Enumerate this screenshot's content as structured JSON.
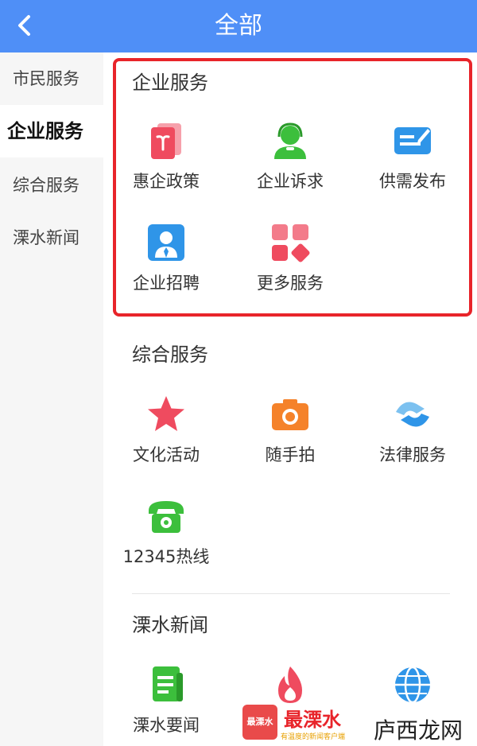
{
  "header": {
    "title": "全部"
  },
  "sidebar": {
    "items": [
      {
        "label": "市民服务"
      },
      {
        "label": "企业服务"
      },
      {
        "label": "综合服务"
      },
      {
        "label": "溧水新闻"
      }
    ]
  },
  "sections": {
    "enterprise": {
      "title": "企业服务",
      "items": [
        {
          "label": "惠企政策",
          "icon": "policy-book-icon",
          "color": "#ef4b5f"
        },
        {
          "label": "企业诉求",
          "icon": "customer-service-icon",
          "color": "#3cbf3c"
        },
        {
          "label": "供需发布",
          "icon": "publish-card-icon",
          "color": "#2f95e8"
        },
        {
          "label": "企业招聘",
          "icon": "recruit-person-icon",
          "color": "#2f95e8"
        },
        {
          "label": "更多服务",
          "icon": "more-grid-icon",
          "color": "#ef4b5f"
        }
      ]
    },
    "general": {
      "title": "综合服务",
      "items": [
        {
          "label": "文化活动",
          "icon": "star-icon",
          "color": "#ef4b5f"
        },
        {
          "label": "随手拍",
          "icon": "camera-icon",
          "color": "#f5822a"
        },
        {
          "label": "法律服务",
          "icon": "handshake-icon",
          "color": "#2f95e8"
        },
        {
          "label": "12345热线",
          "icon": "phone-icon",
          "color": "#3cbf3c"
        }
      ]
    },
    "news": {
      "title": "溧水新闻",
      "items": [
        {
          "label": "溧水要闻",
          "icon": "news-doc-icon",
          "color": "#3cbf3c"
        },
        {
          "label": "",
          "icon": "flame-icon",
          "color": "#ef4b5f"
        },
        {
          "label": "",
          "icon": "globe-icon",
          "color": "#2f95e8"
        }
      ]
    }
  },
  "watermark": {
    "logo_text": "最溧水",
    "brand": "最溧水",
    "tagline": "有温度的新闻客户端",
    "brand2": "庐西龙网"
  }
}
